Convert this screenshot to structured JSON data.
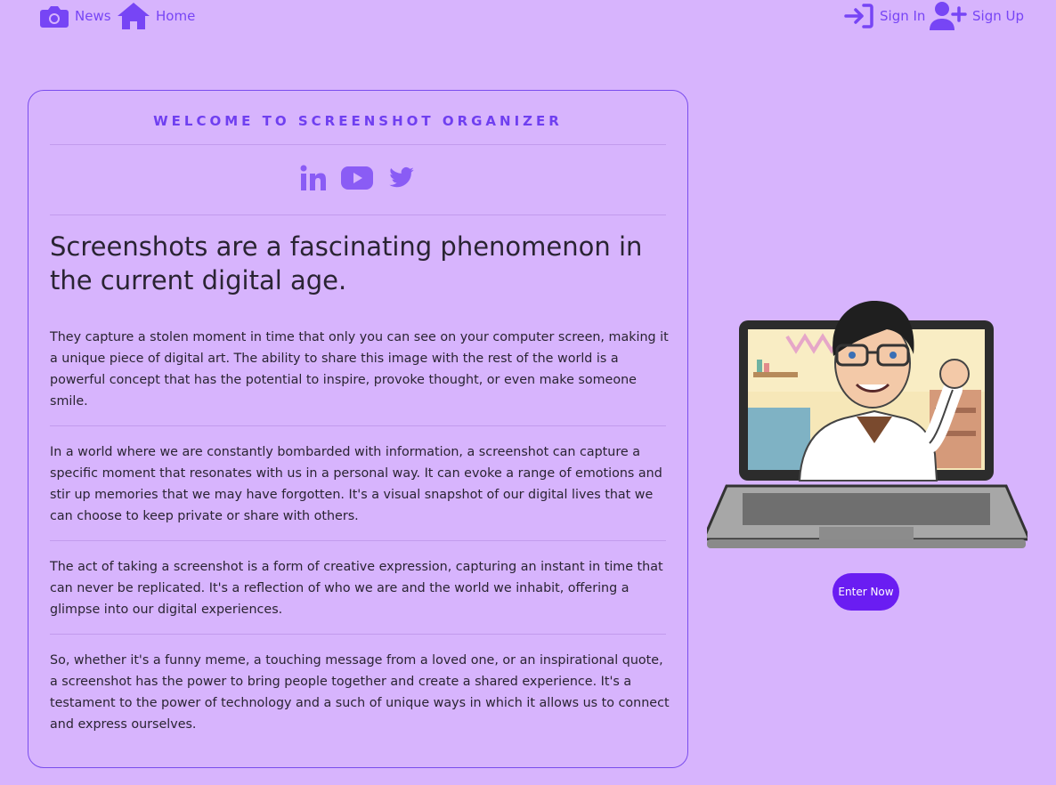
{
  "nav": {
    "news": {
      "label": "News",
      "icon": "camera-icon"
    },
    "home": {
      "label": "Home",
      "icon": "home-icon"
    },
    "signin": {
      "label": "Sign In",
      "icon": "sign-in-icon"
    },
    "signup": {
      "label": "Sign Up",
      "icon": "user-plus-icon"
    }
  },
  "card": {
    "title": "WELCOME TO SCREENSHOT ORGANIZER",
    "social_icons": [
      "linkedin-icon",
      "youtube-icon",
      "twitter-icon"
    ],
    "headline": "Screenshots are a fascinating phenomenon in the current digital age.",
    "paragraphs": [
      "They capture a stolen moment in time that only you can see on your computer screen, making it a unique piece of digital art. The ability to share this image with the rest of the world is a powerful concept that has the potential to inspire, provoke thought, or even make someone smile.",
      "In a world where we are constantly bombarded with information, a screenshot can capture a specific moment that resonates with us in a personal way. It can evoke a range of emotions and stir up memories that we may have forgotten. It's a visual snapshot of our digital lives that we can choose to keep private or share with others.",
      "The act of taking a screenshot is a form of creative expression, capturing an instant in time that can never be replicated. It's a reflection of who we are and the world we inhabit, offering a glimpse into our digital experiences.",
      "So, whether it's a funny meme, a touching message from a loved one, or an inspirational quote, a screenshot has the power to bring people together and create a shared experience. It's a testament to the power of technology and a such of unique ways in which it allows us to connect and express ourselves."
    ]
  },
  "hero": {
    "enter_label": "Enter Now"
  },
  "colors": {
    "background": "#d7b4fd",
    "accent": "#7745f5",
    "button": "#6a1df2"
  }
}
